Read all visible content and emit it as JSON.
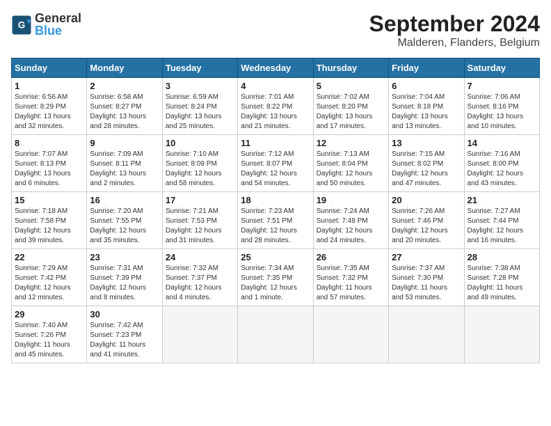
{
  "header": {
    "logo_line1": "General",
    "logo_line2": "Blue",
    "month": "September 2024",
    "location": "Malderen, Flanders, Belgium"
  },
  "days_of_week": [
    "Sunday",
    "Monday",
    "Tuesday",
    "Wednesday",
    "Thursday",
    "Friday",
    "Saturday"
  ],
  "weeks": [
    [
      {
        "day": 1,
        "lines": [
          "Sunrise: 6:56 AM",
          "Sunset: 8:29 PM",
          "Daylight: 13 hours",
          "and 32 minutes."
        ]
      },
      {
        "day": 2,
        "lines": [
          "Sunrise: 6:58 AM",
          "Sunset: 8:27 PM",
          "Daylight: 13 hours",
          "and 28 minutes."
        ]
      },
      {
        "day": 3,
        "lines": [
          "Sunrise: 6:59 AM",
          "Sunset: 8:24 PM",
          "Daylight: 13 hours",
          "and 25 minutes."
        ]
      },
      {
        "day": 4,
        "lines": [
          "Sunrise: 7:01 AM",
          "Sunset: 8:22 PM",
          "Daylight: 13 hours",
          "and 21 minutes."
        ]
      },
      {
        "day": 5,
        "lines": [
          "Sunrise: 7:02 AM",
          "Sunset: 8:20 PM",
          "Daylight: 13 hours",
          "and 17 minutes."
        ]
      },
      {
        "day": 6,
        "lines": [
          "Sunrise: 7:04 AM",
          "Sunset: 8:18 PM",
          "Daylight: 13 hours",
          "and 13 minutes."
        ]
      },
      {
        "day": 7,
        "lines": [
          "Sunrise: 7:06 AM",
          "Sunset: 8:16 PM",
          "Daylight: 13 hours",
          "and 10 minutes."
        ]
      }
    ],
    [
      {
        "day": 8,
        "lines": [
          "Sunrise: 7:07 AM",
          "Sunset: 8:13 PM",
          "Daylight: 13 hours",
          "and 6 minutes."
        ]
      },
      {
        "day": 9,
        "lines": [
          "Sunrise: 7:09 AM",
          "Sunset: 8:11 PM",
          "Daylight: 13 hours",
          "and 2 minutes."
        ]
      },
      {
        "day": 10,
        "lines": [
          "Sunrise: 7:10 AM",
          "Sunset: 8:09 PM",
          "Daylight: 12 hours",
          "and 58 minutes."
        ]
      },
      {
        "day": 11,
        "lines": [
          "Sunrise: 7:12 AM",
          "Sunset: 8:07 PM",
          "Daylight: 12 hours",
          "and 54 minutes."
        ]
      },
      {
        "day": 12,
        "lines": [
          "Sunrise: 7:13 AM",
          "Sunset: 8:04 PM",
          "Daylight: 12 hours",
          "and 50 minutes."
        ]
      },
      {
        "day": 13,
        "lines": [
          "Sunrise: 7:15 AM",
          "Sunset: 8:02 PM",
          "Daylight: 12 hours",
          "and 47 minutes."
        ]
      },
      {
        "day": 14,
        "lines": [
          "Sunrise: 7:16 AM",
          "Sunset: 8:00 PM",
          "Daylight: 12 hours",
          "and 43 minutes."
        ]
      }
    ],
    [
      {
        "day": 15,
        "lines": [
          "Sunrise: 7:18 AM",
          "Sunset: 7:58 PM",
          "Daylight: 12 hours",
          "and 39 minutes."
        ]
      },
      {
        "day": 16,
        "lines": [
          "Sunrise: 7:20 AM",
          "Sunset: 7:55 PM",
          "Daylight: 12 hours",
          "and 35 minutes."
        ]
      },
      {
        "day": 17,
        "lines": [
          "Sunrise: 7:21 AM",
          "Sunset: 7:53 PM",
          "Daylight: 12 hours",
          "and 31 minutes."
        ]
      },
      {
        "day": 18,
        "lines": [
          "Sunrise: 7:23 AM",
          "Sunset: 7:51 PM",
          "Daylight: 12 hours",
          "and 28 minutes."
        ]
      },
      {
        "day": 19,
        "lines": [
          "Sunrise: 7:24 AM",
          "Sunset: 7:48 PM",
          "Daylight: 12 hours",
          "and 24 minutes."
        ]
      },
      {
        "day": 20,
        "lines": [
          "Sunrise: 7:26 AM",
          "Sunset: 7:46 PM",
          "Daylight: 12 hours",
          "and 20 minutes."
        ]
      },
      {
        "day": 21,
        "lines": [
          "Sunrise: 7:27 AM",
          "Sunset: 7:44 PM",
          "Daylight: 12 hours",
          "and 16 minutes."
        ]
      }
    ],
    [
      {
        "day": 22,
        "lines": [
          "Sunrise: 7:29 AM",
          "Sunset: 7:42 PM",
          "Daylight: 12 hours",
          "and 12 minutes."
        ]
      },
      {
        "day": 23,
        "lines": [
          "Sunrise: 7:31 AM",
          "Sunset: 7:39 PM",
          "Daylight: 12 hours",
          "and 8 minutes."
        ]
      },
      {
        "day": 24,
        "lines": [
          "Sunrise: 7:32 AM",
          "Sunset: 7:37 PM",
          "Daylight: 12 hours",
          "and 4 minutes."
        ]
      },
      {
        "day": 25,
        "lines": [
          "Sunrise: 7:34 AM",
          "Sunset: 7:35 PM",
          "Daylight: 12 hours",
          "and 1 minute."
        ]
      },
      {
        "day": 26,
        "lines": [
          "Sunrise: 7:35 AM",
          "Sunset: 7:32 PM",
          "Daylight: 11 hours",
          "and 57 minutes."
        ]
      },
      {
        "day": 27,
        "lines": [
          "Sunrise: 7:37 AM",
          "Sunset: 7:30 PM",
          "Daylight: 11 hours",
          "and 53 minutes."
        ]
      },
      {
        "day": 28,
        "lines": [
          "Sunrise: 7:38 AM",
          "Sunset: 7:28 PM",
          "Daylight: 11 hours",
          "and 49 minutes."
        ]
      }
    ],
    [
      {
        "day": 29,
        "lines": [
          "Sunrise: 7:40 AM",
          "Sunset: 7:26 PM",
          "Daylight: 11 hours",
          "and 45 minutes."
        ]
      },
      {
        "day": 30,
        "lines": [
          "Sunrise: 7:42 AM",
          "Sunset: 7:23 PM",
          "Daylight: 11 hours",
          "and 41 minutes."
        ]
      },
      null,
      null,
      null,
      null,
      null
    ]
  ]
}
